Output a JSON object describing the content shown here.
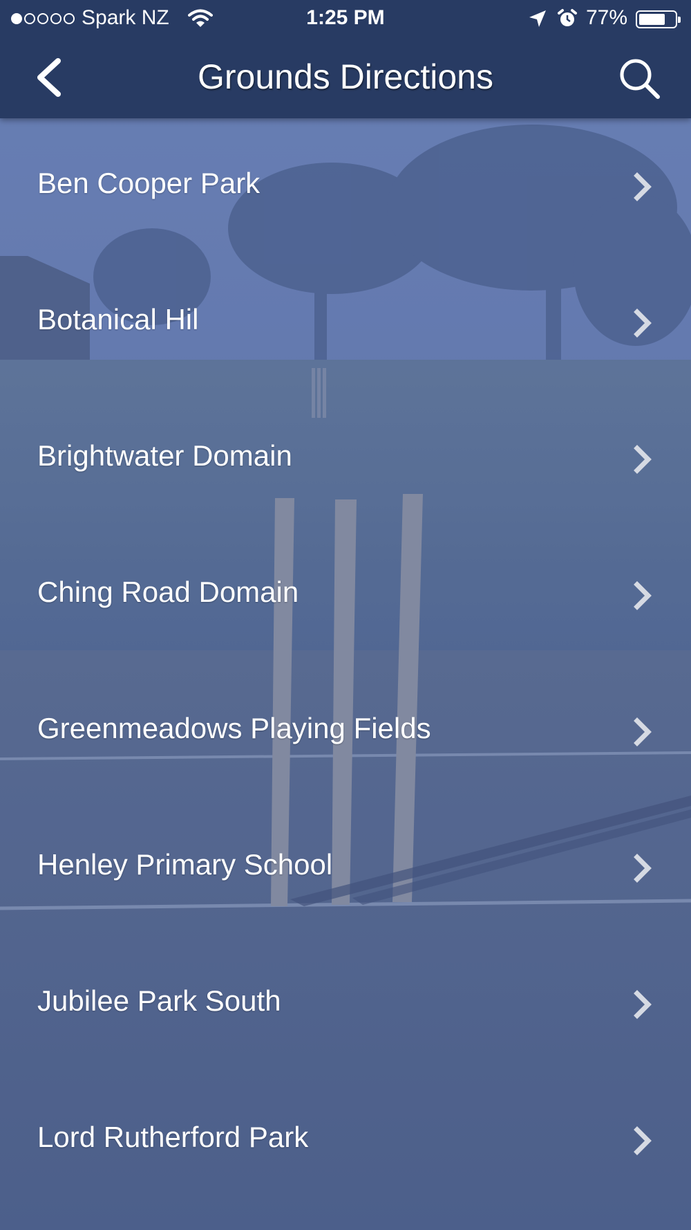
{
  "status_bar": {
    "carrier": "Spark NZ",
    "time": "1:25 PM",
    "battery_percent": "77%",
    "battery_level": 0.77,
    "signal_bars_filled": 1,
    "signal_bars_total": 5
  },
  "nav": {
    "title": "Grounds Directions",
    "back_icon": "chevron-left-icon",
    "search_icon": "search-icon"
  },
  "grounds": [
    {
      "label": "Ben Cooper Park"
    },
    {
      "label": "Botanical Hil"
    },
    {
      "label": "Brightwater Domain"
    },
    {
      "label": "Ching Road Domain"
    },
    {
      "label": "Greenmeadows Playing Fields"
    },
    {
      "label": "Henley Primary School"
    },
    {
      "label": "Jubilee Park South"
    },
    {
      "label": "Lord Rutherford Park"
    }
  ],
  "colors": {
    "nav_background": "#283b63",
    "overlay_tint": "#5a6fa6",
    "text": "#ffffff",
    "chevron": "#d6dae3"
  }
}
